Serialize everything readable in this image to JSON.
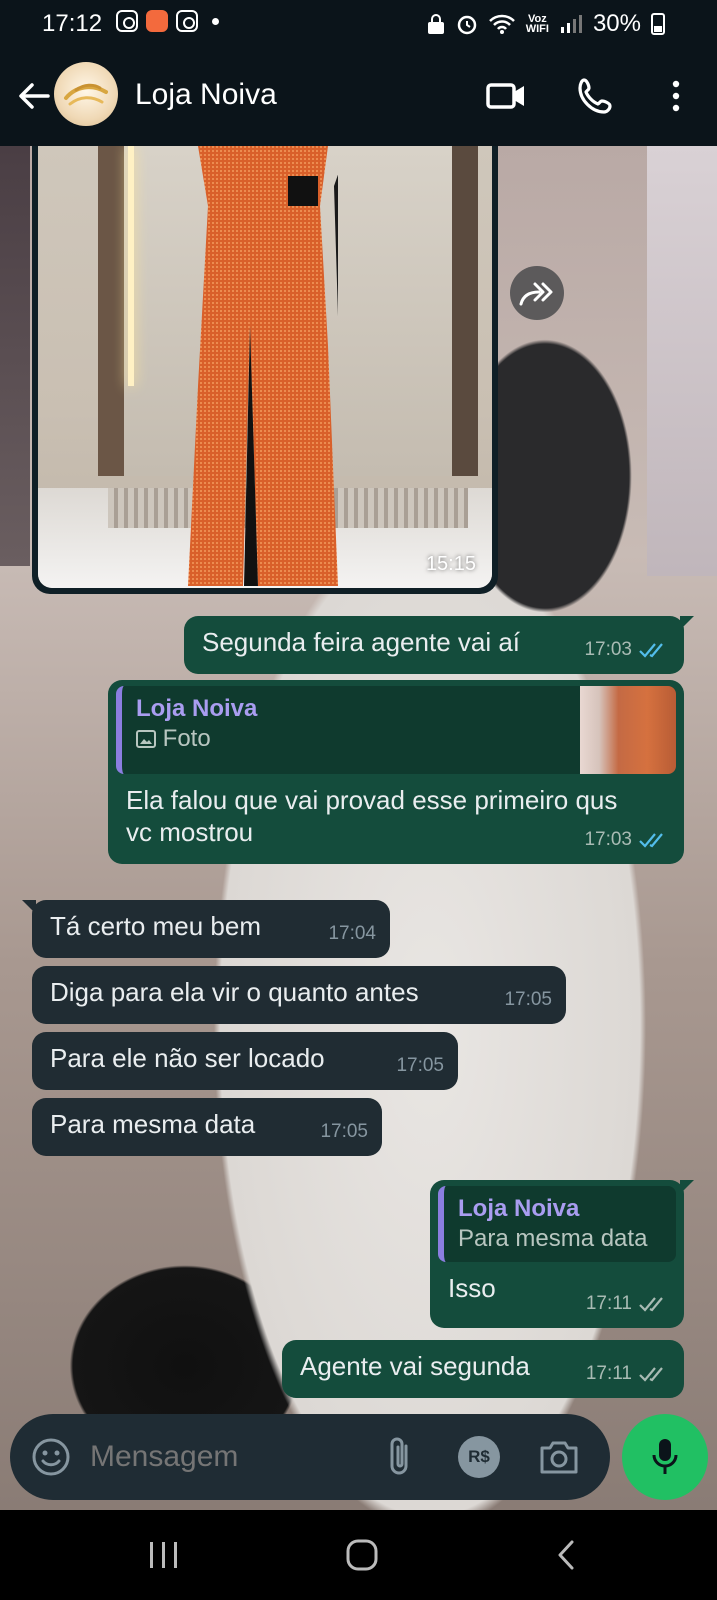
{
  "status_bar": {
    "time": "17:12",
    "network_label_top": "Voz",
    "network_label_bottom": "WIFI",
    "battery": "30%"
  },
  "header": {
    "contact_name": "Loja Noiva",
    "icons": [
      "back-arrow-icon",
      "video-call-icon",
      "phone-call-icon",
      "more-menu-icon"
    ]
  },
  "messages": [
    {
      "id": "photo",
      "direction": "in",
      "type": "image",
      "time": "15:15"
    },
    {
      "id": "m1",
      "direction": "out",
      "text": "Segunda feira agente vai aí",
      "time": "17:03",
      "status": "read"
    },
    {
      "id": "m2",
      "direction": "out",
      "quote": {
        "author": "Loja Noiva",
        "text": "Foto"
      },
      "text": "Ela falou que vai provad esse primeiro qus vc mostrou",
      "time": "17:03",
      "status": "read"
    },
    {
      "id": "m3",
      "direction": "in",
      "text": "Tá certo meu bem",
      "time": "17:04"
    },
    {
      "id": "m4",
      "direction": "in",
      "text": "Diga para ela vir o quanto antes",
      "time": "17:05"
    },
    {
      "id": "m5",
      "direction": "in",
      "text": "Para ele não ser locado",
      "time": "17:05"
    },
    {
      "id": "m6",
      "direction": "in",
      "text": "Para mesma data",
      "time": "17:05"
    },
    {
      "id": "m7",
      "direction": "out",
      "quote": {
        "author": "Loja Noiva",
        "text": "Para mesma data"
      },
      "text": "Isso",
      "time": "17:11",
      "status": "delivered"
    },
    {
      "id": "m8",
      "direction": "out",
      "text": "Agente vai segunda",
      "time": "17:11",
      "status": "delivered"
    }
  ],
  "composer": {
    "placeholder": "Mensagem",
    "payment_label": "R$"
  },
  "colors": {
    "outgoing_bubble": "#144c3c",
    "incoming_bubble": "#202c33",
    "read_ticks": "#53bdeb",
    "mic_button": "#21c063",
    "quote_author": "#a99df0"
  }
}
